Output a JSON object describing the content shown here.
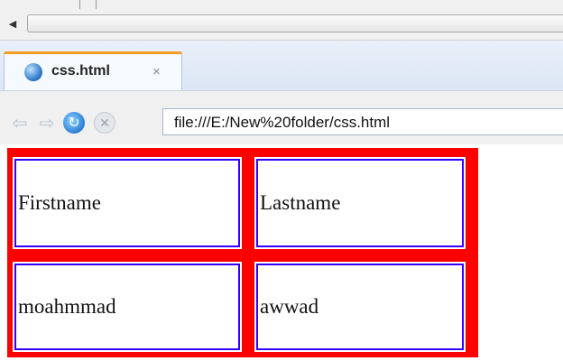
{
  "tab": {
    "title": "css.html",
    "close_glyph": "×",
    "accent_color": "#f39c23"
  },
  "nav": {
    "back_icon": "arrow-left-icon",
    "forward_icon": "arrow-right-icon",
    "reload_icon": "reload-icon",
    "stop_icon": "stop-icon",
    "url": "file:///E:/New%20folder/css.html"
  },
  "table": {
    "border_color": "#ff0000",
    "inner_border_color": "#3300ff",
    "rows": [
      [
        "Firstname",
        "Lastname"
      ],
      [
        "moahmmad",
        "awwad"
      ]
    ]
  }
}
